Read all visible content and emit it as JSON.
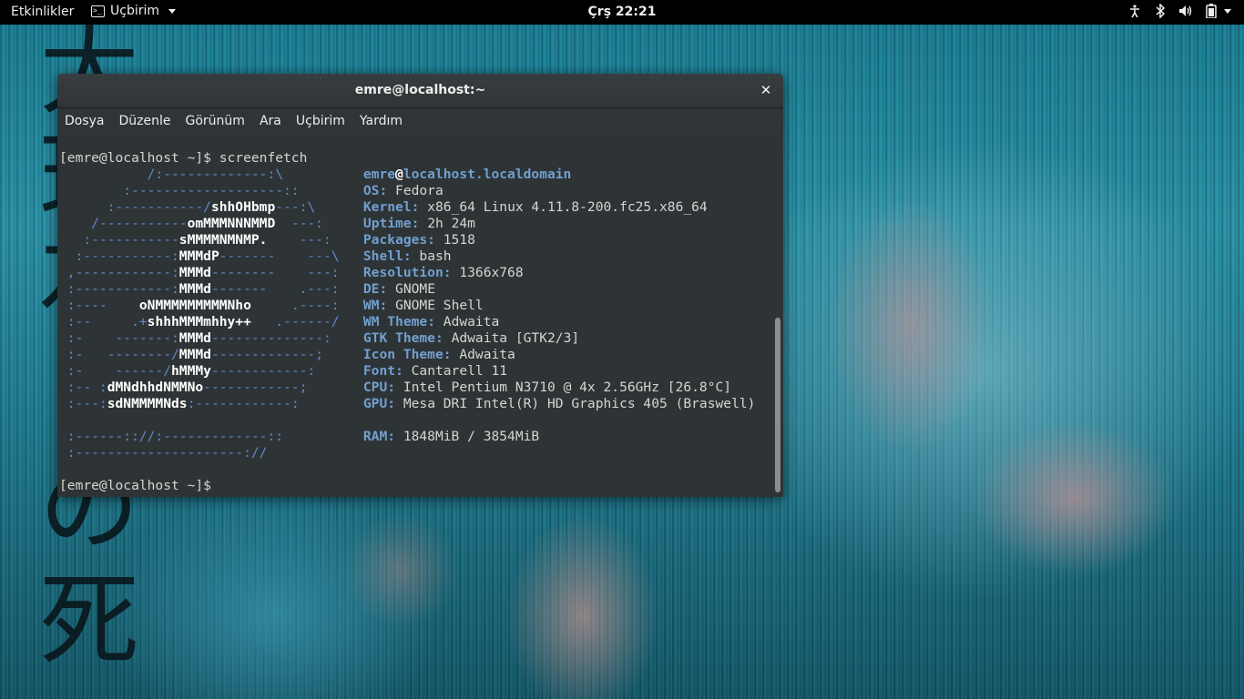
{
  "topbar": {
    "activities": "Etkinlikler",
    "app_menu": "Uçbirim",
    "clock": "Çrş 22:21"
  },
  "window": {
    "title": "emre@localhost:~",
    "close_glyph": "✕",
    "menu": [
      "Dosya",
      "Düzenle",
      "Görünüm",
      "Ara",
      "Uçbirim",
      "Yardım"
    ]
  },
  "terminal": {
    "prompt": "[emre@localhost ~]$",
    "command": "screenfetch",
    "user": "emre",
    "host": "localhost.localdomain",
    "info": [
      {
        "key": "OS:",
        "value": "Fedora"
      },
      {
        "key": "Kernel:",
        "value": "x86_64 Linux 4.11.8-200.fc25.x86_64"
      },
      {
        "key": "Uptime:",
        "value": "2h 24m"
      },
      {
        "key": "Packages:",
        "value": "1518"
      },
      {
        "key": "Shell:",
        "value": "bash"
      },
      {
        "key": "Resolution:",
        "value": "1366x768"
      },
      {
        "key": "DE:",
        "value": "GNOME"
      },
      {
        "key": "WM:",
        "value": "GNOME Shell"
      },
      {
        "key": "WM Theme:",
        "value": "Adwaita"
      },
      {
        "key": "GTK Theme:",
        "value": "Adwaita [GTK2/3]"
      },
      {
        "key": "Icon Theme:",
        "value": "Adwaita"
      },
      {
        "key": "Font:",
        "value": "Cantarell 11"
      },
      {
        "key": "CPU:",
        "value": "Intel Pentium N3710 @ 4x 2.56GHz [26.8°C]"
      },
      {
        "key": "GPU:",
        "value": "Mesa DRI Intel(R) HD Graphics 405 (Braswell)"
      },
      {
        "key": "RAM:",
        "value": "1848MiB / 3854MiB"
      }
    ],
    "logo": [
      "           /:-------------:\\",
      "        :-------------------::",
      "      :-----------/shhOHbmp---:\\",
      "    /-----------omMMMNNNMMD  ---:",
      "   :-----------sMMMMNMNMP.    ---:",
      "  :-----------:MMMdP-------    ---\\",
      " ,------------:MMMd--------    ---:",
      " :------------:MMMd-------    .---:",
      " :----    oNMMMMMMMMMNho     .----:",
      " :--     .+shhhMMMmhhy++   .------/",
      " :-    -------:MMMd--------------:",
      " :-   --------/MMMd-------------;",
      " :-    ------/hMMMy------------:",
      " :-- :dMNdhhdNMMNo------------;",
      " :---:sdNMMMMNds:------------:",
      "",
      " :------:://:-------------::",
      " :---------------------://"
    ]
  },
  "wallpaper": {
    "kanji": [
      "大",
      "理",
      "石",
      "の",
      "死"
    ]
  }
}
